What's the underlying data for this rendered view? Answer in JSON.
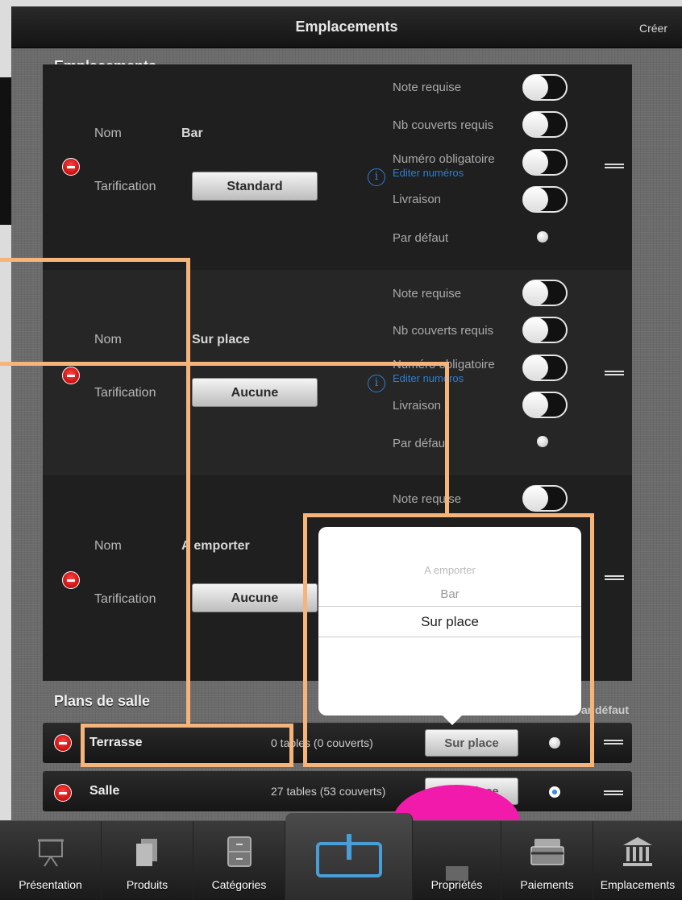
{
  "topbar": {
    "title": "Emplacements",
    "create_label": "Créer"
  },
  "sections": {
    "emplacements": "Emplacements",
    "plans": "Plans de salle"
  },
  "field_labels": {
    "nom": "Nom",
    "tarification": "Tarification"
  },
  "option_labels": {
    "note": "Note requise",
    "couverts": "Nb couverts requis",
    "numero": "Numéro obligatoire",
    "editer": "Editer numéros",
    "livraison": "Livraison",
    "defaut": "Par défaut"
  },
  "locations": [
    {
      "name": "Bar",
      "pricing": "Standard"
    },
    {
      "name": "Sur place",
      "pricing": "Aucune"
    },
    {
      "name": "A emporter",
      "pricing": "Aucune"
    }
  ],
  "plans_default_header": "Par défaut",
  "plans": [
    {
      "name": "Terrasse",
      "meta": "0 tables (0 couverts)",
      "location": "Sur place",
      "default": false
    },
    {
      "name": "Salle",
      "meta": "27 tables (53 couverts)",
      "location": "Sur place",
      "default": true
    }
  ],
  "picker": {
    "options": [
      "A emporter",
      "Bar",
      "Sur place"
    ],
    "selected": "Sur place"
  },
  "tabs": [
    {
      "label": "Présentation",
      "icon": "presentation-icon"
    },
    {
      "label": "Produits",
      "icon": "products-icon"
    },
    {
      "label": "Catégories",
      "icon": "categories-icon"
    },
    {
      "label": "",
      "icon": "power-icon"
    },
    {
      "label": "Propriétés",
      "icon": "properties-icon"
    },
    {
      "label": "Paiements",
      "icon": "payments-icon"
    },
    {
      "label": "Emplacements",
      "icon": "locations-icon"
    }
  ],
  "colors": {
    "accent": "#2c7fd6",
    "delete": "#c81010",
    "highlight": "#f5b47a",
    "blob": "#f21aab"
  }
}
